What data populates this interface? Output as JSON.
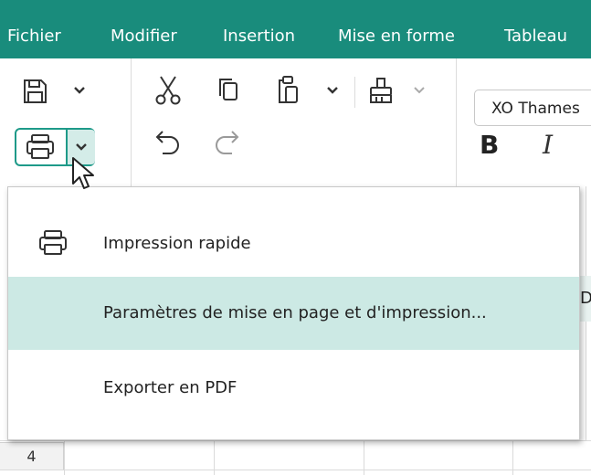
{
  "menubar": {
    "items": [
      {
        "label": "Fichier"
      },
      {
        "label": "Modifier"
      },
      {
        "label": "Insertion"
      },
      {
        "label": "Mise en forme"
      },
      {
        "label": "Tableau"
      }
    ]
  },
  "toolbar": {
    "font_name": "XO Thames",
    "bold_label": "B",
    "italic_label": "I"
  },
  "grid": {
    "row_label": "4",
    "peek_text": "D"
  },
  "dropdown": {
    "items": [
      {
        "label": "Impression rapide",
        "icon": "printer-icon"
      },
      {
        "label": "Paramètres de mise en page et d'impression...",
        "highlighted": true
      },
      {
        "label": "Exporter en PDF"
      }
    ]
  },
  "colors": {
    "menubar_bg": "#198c7c",
    "accent": "#1e9a89",
    "highlight": "#cce9e4"
  }
}
